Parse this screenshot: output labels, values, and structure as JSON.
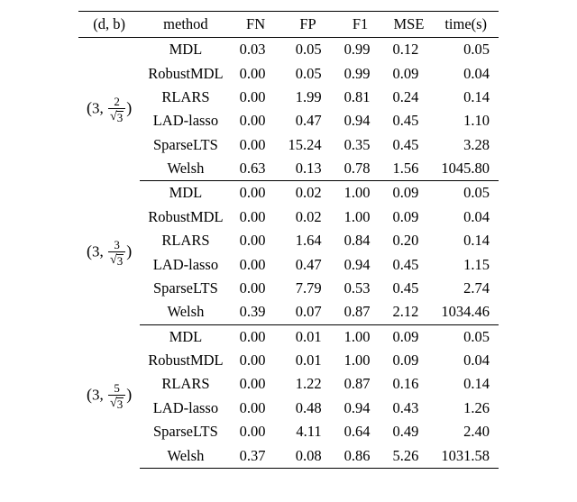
{
  "chart_data": {
    "type": "table",
    "columns": [
      "(d, b)",
      "method",
      "FN",
      "FP",
      "F1",
      "MSE",
      "time(s)"
    ],
    "groups": [
      {
        "label_tex": "(3, 2/\\sqrt{3})",
        "d": 3,
        "num": 2,
        "den_sqrt": 3,
        "rows": [
          {
            "method": "MDL",
            "FN": "0.03",
            "FP": "0.05",
            "F1": "0.99",
            "MSE": "0.12",
            "time": "0.05"
          },
          {
            "method": "RobustMDL",
            "FN": "0.00",
            "FP": "0.05",
            "F1": "0.99",
            "MSE": "0.09",
            "time": "0.04"
          },
          {
            "method": "RLARS",
            "FN": "0.00",
            "FP": "1.99",
            "F1": "0.81",
            "MSE": "0.24",
            "time": "0.14"
          },
          {
            "method": "LAD-lasso",
            "FN": "0.00",
            "FP": "0.47",
            "F1": "0.94",
            "MSE": "0.45",
            "time": "1.10"
          },
          {
            "method": "SparseLTS",
            "FN": "0.00",
            "FP": "15.24",
            "F1": "0.35",
            "MSE": "0.45",
            "time": "3.28"
          },
          {
            "method": "Welsh",
            "FN": "0.63",
            "FP": "0.13",
            "F1": "0.78",
            "MSE": "1.56",
            "time": "1045.80"
          }
        ]
      },
      {
        "label_tex": "(3, 3/\\sqrt{3})",
        "d": 3,
        "num": 3,
        "den_sqrt": 3,
        "rows": [
          {
            "method": "MDL",
            "FN": "0.00",
            "FP": "0.02",
            "F1": "1.00",
            "MSE": "0.09",
            "time": "0.05"
          },
          {
            "method": "RobustMDL",
            "FN": "0.00",
            "FP": "0.02",
            "F1": "1.00",
            "MSE": "0.09",
            "time": "0.04"
          },
          {
            "method": "RLARS",
            "FN": "0.00",
            "FP": "1.64",
            "F1": "0.84",
            "MSE": "0.20",
            "time": "0.14"
          },
          {
            "method": "LAD-lasso",
            "FN": "0.00",
            "FP": "0.47",
            "F1": "0.94",
            "MSE": "0.45",
            "time": "1.15"
          },
          {
            "method": "SparseLTS",
            "FN": "0.00",
            "FP": "7.79",
            "F1": "0.53",
            "MSE": "0.45",
            "time": "2.74"
          },
          {
            "method": "Welsh",
            "FN": "0.39",
            "FP": "0.07",
            "F1": "0.87",
            "MSE": "2.12",
            "time": "1034.46"
          }
        ]
      },
      {
        "label_tex": "(3, 5/\\sqrt{3})",
        "d": 3,
        "num": 5,
        "den_sqrt": 3,
        "rows": [
          {
            "method": "MDL",
            "FN": "0.00",
            "FP": "0.01",
            "F1": "1.00",
            "MSE": "0.09",
            "time": "0.05"
          },
          {
            "method": "RobustMDL",
            "FN": "0.00",
            "FP": "0.01",
            "F1": "1.00",
            "MSE": "0.09",
            "time": "0.04"
          },
          {
            "method": "RLARS",
            "FN": "0.00",
            "FP": "1.22",
            "F1": "0.87",
            "MSE": "0.16",
            "time": "0.14"
          },
          {
            "method": "LAD-lasso",
            "FN": "0.00",
            "FP": "0.48",
            "F1": "0.94",
            "MSE": "0.43",
            "time": "1.26"
          },
          {
            "method": "SparseLTS",
            "FN": "0.00",
            "FP": "4.11",
            "F1": "0.64",
            "MSE": "0.49",
            "time": "2.40"
          },
          {
            "method": "Welsh",
            "FN": "0.37",
            "FP": "0.08",
            "F1": "0.86",
            "MSE": "5.26",
            "time": "1031.58"
          }
        ]
      }
    ]
  }
}
